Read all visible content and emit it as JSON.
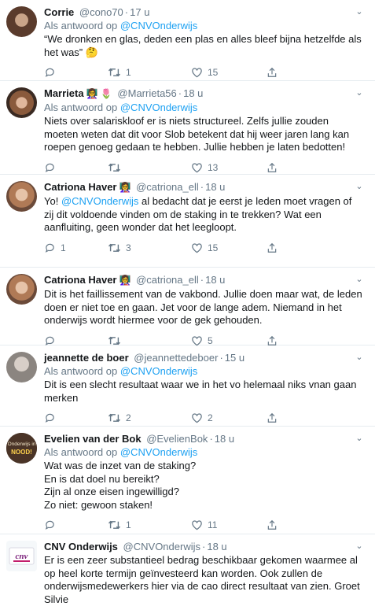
{
  "tweets": [
    {
      "name": "Corrie",
      "emoji": "",
      "handle": "@cono70",
      "time": "17 u",
      "reply_prefix": "Als antwoord op",
      "reply_to": "@CNVOnderwijs",
      "text": "“We dronken en glas, deden een plas en alles bleef bijna hetzelfde als het was” 🤔",
      "replies": "",
      "retweets": "1",
      "likes": "15"
    },
    {
      "name": "Marrieta",
      "emoji": "👩‍🏫 🌷",
      "handle": "@Marrieta56",
      "time": "18 u",
      "reply_prefix": "Als antwoord op",
      "reply_to": "@CNVOnderwijs",
      "text": "Niets over salariskloof er is niets structureel. Zelfs jullie zouden moeten weten dat dit voor Slob betekent dat hij weer jaren lang kan roepen genoeg gedaan te hebben. Jullie hebben je laten bedotten!",
      "replies": "",
      "retweets": "",
      "likes": "13"
    },
    {
      "name": "Catriona Haver",
      "emoji": "👩‍🏫",
      "handle": "@catriona_ell",
      "time": "18 u",
      "reply_prefix": "",
      "reply_to": "@CNVOnderwijs",
      "text_prefix": "Yo! ",
      "text": " al bedacht dat je eerst je leden moet vragen of zij dit voldoende vinden om de staking in te trekken? Wat een aanfluiting, geen wonder dat het leegloopt.",
      "replies": "1",
      "retweets": "3",
      "likes": "15"
    },
    {
      "name": "Catriona Haver",
      "emoji": "👩‍🏫",
      "handle": "@catriona_ell",
      "time": "18 u",
      "reply_prefix": "",
      "reply_to": "",
      "text": "Dit is het faillissement van de vakbond. Jullie doen maar wat, de leden doen er niet toe en gaan. Jet voor de lange adem. Niemand in het onderwijs wordt hiermee voor de gek gehouden.",
      "replies": "",
      "retweets": "",
      "likes": "5"
    },
    {
      "name": "jeannette de boer",
      "emoji": "",
      "handle": "@jeannettedeboer",
      "time": "15 u",
      "reply_prefix": "Als antwoord op",
      "reply_to": "@CNVOnderwijs",
      "text": "Dit is een slecht resultaat waar we in het vo helemaal niks vnan gaan merken",
      "replies": "",
      "retweets": "2",
      "likes": "2"
    },
    {
      "name": "Evelien van der Bok",
      "emoji": "",
      "handle": "@EvelienBok",
      "time": "18 u",
      "reply_prefix": "Als antwoord op",
      "reply_to": "@CNVOnderwijs",
      "text": "Wat was de inzet van de staking?\nEn is dat doel nu bereikt?\nZijn al onze eisen ingewilligd?\nZo niet: gewoon staken!",
      "replies": "",
      "retweets": "1",
      "likes": "11"
    },
    {
      "name": "CNV Onderwijs",
      "emoji": "",
      "handle": "@CNVOnderwijs",
      "time": "18 u",
      "reply_prefix": "",
      "reply_to": "",
      "text": "Er is een zeer substantieel bedrag beschikbaar gekomen waarmee al op heel korte termijn geïnvesteerd kan worden. Ook zullen de onderwijsmedewerkers hier via de cao direct resultaat van zien. Groet Silvie",
      "replies": "",
      "retweets": "",
      "likes": ""
    }
  ],
  "avatar_logos": {
    "evelien": [
      "Onderwijs in",
      "NOOD!"
    ],
    "cnv": "cnv"
  },
  "colors": {
    "link": "#1da1f2",
    "secondary": "#657786",
    "text": "#14171a",
    "divider": "#e6ecf0"
  }
}
